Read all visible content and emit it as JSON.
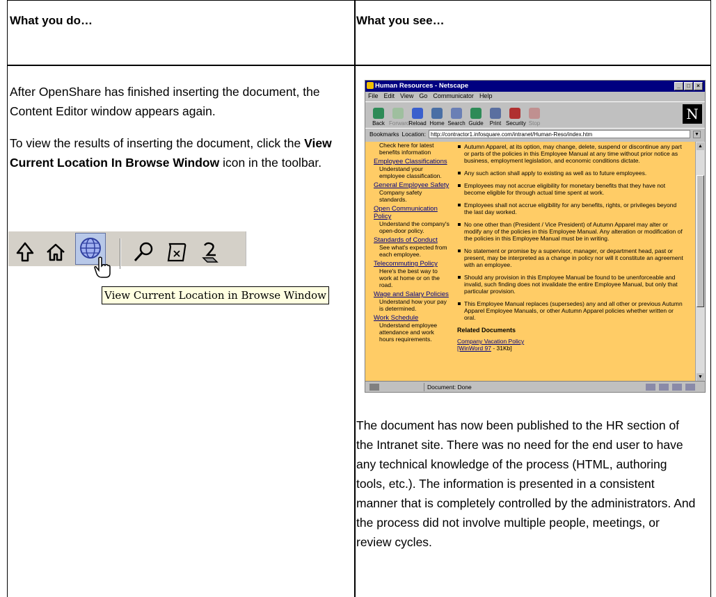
{
  "headers": {
    "left": "What you do…",
    "right": "What you see…"
  },
  "left_column": {
    "para1": "After OpenShare has finished inserting the document, the Content Editor window appears again.",
    "para2_pre": "To view the results of inserting the document, click the ",
    "para2_bold": "View Current Location In Browse Window",
    "para2_post": " icon in the toolbar."
  },
  "toolbar_snippet": {
    "icons": [
      "up-arrow-icon",
      "home-icon",
      "globe-icon",
      "search-icon",
      "edit-document-icon",
      "properties-icon"
    ],
    "tooltip": "View Current Location in Browse Window"
  },
  "browser": {
    "title": "Human Resources - Netscape",
    "menu": [
      "File",
      "Edit",
      "View",
      "Go",
      "Communicator",
      "Help"
    ],
    "nav_buttons": [
      {
        "label": "Back",
        "enabled": true,
        "color": "#2e8b57"
      },
      {
        "label": "Forward",
        "enabled": false,
        "color": "#9fbf9f"
      },
      {
        "label": "Reload",
        "enabled": true,
        "color": "#3a5fcd"
      },
      {
        "label": "Home",
        "enabled": true,
        "color": "#4a6fa5"
      },
      {
        "label": "Search",
        "enabled": true,
        "color": "#6a7fb5"
      },
      {
        "label": "Guide",
        "enabled": true,
        "color": "#2e8b57"
      },
      {
        "label": "Print",
        "enabled": true,
        "color": "#5a6fa0"
      },
      {
        "label": "Security",
        "enabled": true,
        "color": "#b03030"
      },
      {
        "label": "Stop",
        "enabled": false,
        "color": "#c09090"
      }
    ],
    "bookmarks_label": "Bookmarks",
    "location_label": "Location:",
    "url": "http://contractor1.infosquare.com/intranet/Human-Reso/index.htm",
    "sidebar": [
      {
        "link": "",
        "desc": "Check here for latest benefits information"
      },
      {
        "link": "Employee Classifications",
        "desc": "Understand your employee classification."
      },
      {
        "link": "General Employee Safety",
        "desc": "Company safety standards."
      },
      {
        "link": "Open Communication Policy",
        "desc": "Understand the company's open-door policy."
      },
      {
        "link": "Standards of Conduct",
        "desc": "See what's expected from each employee."
      },
      {
        "link": "Telecommuting Policy",
        "desc": "Here's the best way to work at home or on the road."
      },
      {
        "link": "Wage and Salary Policies",
        "desc": "Understand how your pay is determined."
      },
      {
        "link": "Work Schedule",
        "desc": "Understand employee attendance and work hours requirements."
      }
    ],
    "bullets": [
      "Autumn Apparel, at its option, may change, delete, suspend or discontinue any part or parts of the policies in this Employee Manual at any time without prior notice as business, employment legislation, and economic conditions dictate.",
      "Any such action shall apply to existing as well as to future employees.",
      "Employees may not accrue eligibility for monetary benefits that they have not become eligible for through actual time spent at work.",
      "Employees shall not accrue eligibility for any benefits, rights, or privileges beyond the last day worked.",
      "No one other than (President / Vice President) of Autumn Apparel may alter or modify any of the policies in this Employee Manual. Any alteration or modification of the policies in this Employee Manual must be in writing.",
      "No statement or promise by a supervisor, manager, or department head, past or present, may be interpreted as a change in policy nor will it constitute an agreement with an employee.",
      "Should any provision in this Employee Manual be found to be unenforceable and invalid, such finding does not invalidate the entire Employee Manual, but only that particular provision.",
      "This Employee Manual replaces (supersedes) any and all other or previous Autumn Apparel Employee Manuals, or other Autumn Apparel policies whether written or oral."
    ],
    "related_heading": "Related Documents",
    "related_link": "Company Vacation Policy",
    "related_meta_link": "[WinWord 97",
    "related_meta_rest": " - 31Kb]",
    "status": "Document: Done"
  },
  "right_paragraph": "The document has now been published to the HR section of the Intranet site. There was no need for the end user to have any technical knowledge of the process (HTML, authoring tools, etc.). The information is presented in a consistent manner that is completely controlled by the administrators. And the process did not involve multiple people, meetings, or review cycles."
}
